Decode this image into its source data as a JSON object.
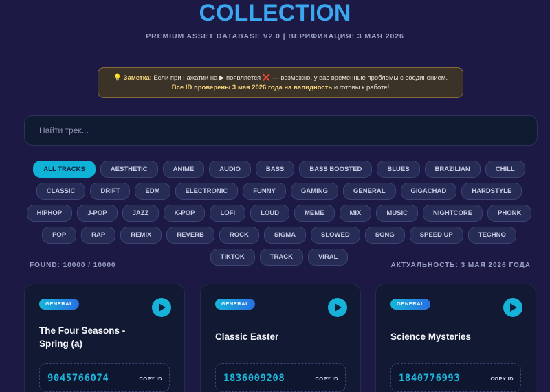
{
  "header": {
    "title": "COLLECTION",
    "subtitle": "PREMIUM ASSET DATABASE V2.0 | ВЕРИФИКАЦИЯ: 3 МАЯ 2026"
  },
  "note": {
    "icon": "lightbulb-icon",
    "label": "Заметка:",
    "line1_text": "Если при нажатии на ▶ появляется",
    "x_icon": "❌",
    "line1_tail": "— возможно, у вас временные проблемы с соединением.",
    "line2_bold": "Все ID проверены 3 мая 2026 года на валидность",
    "line2_tail": "и готовы к работе!"
  },
  "search": {
    "placeholder": "Найти трек..."
  },
  "tags": [
    "ALL TRACKS",
    "AESTHETIC",
    "ANIME",
    "AUDIO",
    "BASS",
    "BASS BOOSTED",
    "BLUES",
    "BRAZILIAN",
    "CHILL",
    "CLASSIC",
    "DRIFT",
    "EDM",
    "ELECTRONIC",
    "FUNNY",
    "GAMING",
    "GENERAL",
    "GIGACHAD",
    "HARDSTYLE",
    "HIPHOP",
    "J-POP",
    "JAZZ",
    "K-POP",
    "LOFI",
    "LOUD",
    "MEME",
    "MIX",
    "MUSIC",
    "NIGHTCORE",
    "PHONK",
    "POP",
    "RAP",
    "REMIX",
    "REVERB",
    "ROCK",
    "SIGMA",
    "SLOWED",
    "SONG",
    "SPEED UP",
    "TECHNO",
    "TIKTOK",
    "TRACK",
    "VIRAL"
  ],
  "active_tag": "ALL TRACKS",
  "stats": {
    "found": "FOUND: 10000 / 10000",
    "actual": "АКТУАЛЬНОСТЬ: 3 МАЯ 2026 ГОДА"
  },
  "cards": [
    {
      "badge": "GENERAL",
      "name": "The Four Seasons - Spring (a)",
      "id": "9045766074",
      "copy": "COPY ID"
    },
    {
      "badge": "GENERAL",
      "name": "Classic Easter",
      "id": "1836009208",
      "copy": "COPY ID"
    },
    {
      "badge": "GENERAL",
      "name": "Science Mysteries",
      "id": "1840776993",
      "copy": "COPY ID"
    }
  ],
  "colors": {
    "background": "#1c1a44",
    "title": "#3aa7f0",
    "accent": "#16b2d8",
    "note_bg": "#3b3328",
    "note_highlight": "#f4d27a"
  }
}
